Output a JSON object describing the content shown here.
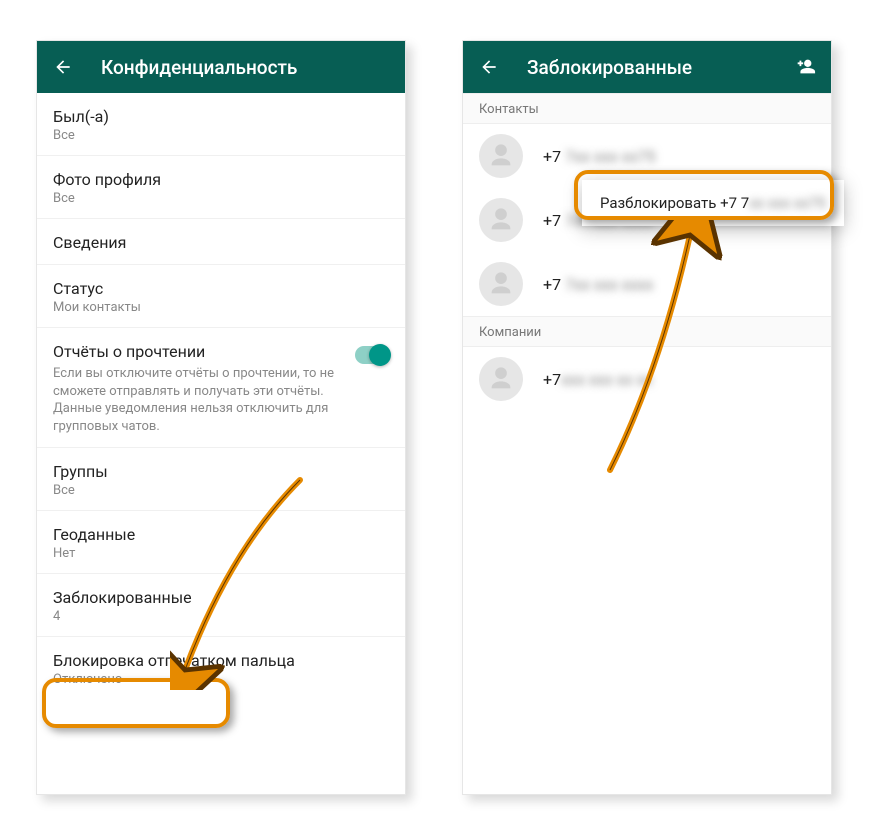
{
  "left": {
    "title": "Конфиденциальность",
    "items": {
      "last_seen": {
        "label": "Был(-а)",
        "sub": "Все"
      },
      "photo": {
        "label": "Фото профиля",
        "sub": "Все"
      },
      "about": {
        "label": "Сведения",
        "sub": ""
      },
      "status": {
        "label": "Статус",
        "sub": "Мои контакты"
      },
      "read": {
        "label": "Отчёты о прочтении",
        "desc": "Если вы отключите отчёты о прочтении, то не сможете отправлять и получать эти отчёты. Данные уведомления нельзя отключить для групповых чатов."
      },
      "groups": {
        "label": "Группы",
        "sub": "Все"
      },
      "geo": {
        "label": "Геоданные",
        "sub": "Нет"
      },
      "blocked": {
        "label": "Заблокированные",
        "sub": "4"
      },
      "finger": {
        "label": "Блокировка отпечатком пальца",
        "sub": "Отключено"
      }
    }
  },
  "right": {
    "title": "Заблокированные",
    "section_contacts": "Контакты",
    "section_companies": "Компании",
    "contacts": [
      {
        "prefix": "+7 ",
        "rest": "7хх ххх хх75"
      },
      {
        "prefix": "+7 ",
        "rest": "7хх ххх хххх"
      },
      {
        "prefix": "+7 ",
        "rest": "7хх ххх хххх"
      }
    ],
    "companies": [
      {
        "prefix": "+7",
        "rest": "ххх ххх хх хх"
      }
    ],
    "context_menu": "Разблокировать +7 7",
    "context_menu_blur": "хх ххх хх75"
  }
}
